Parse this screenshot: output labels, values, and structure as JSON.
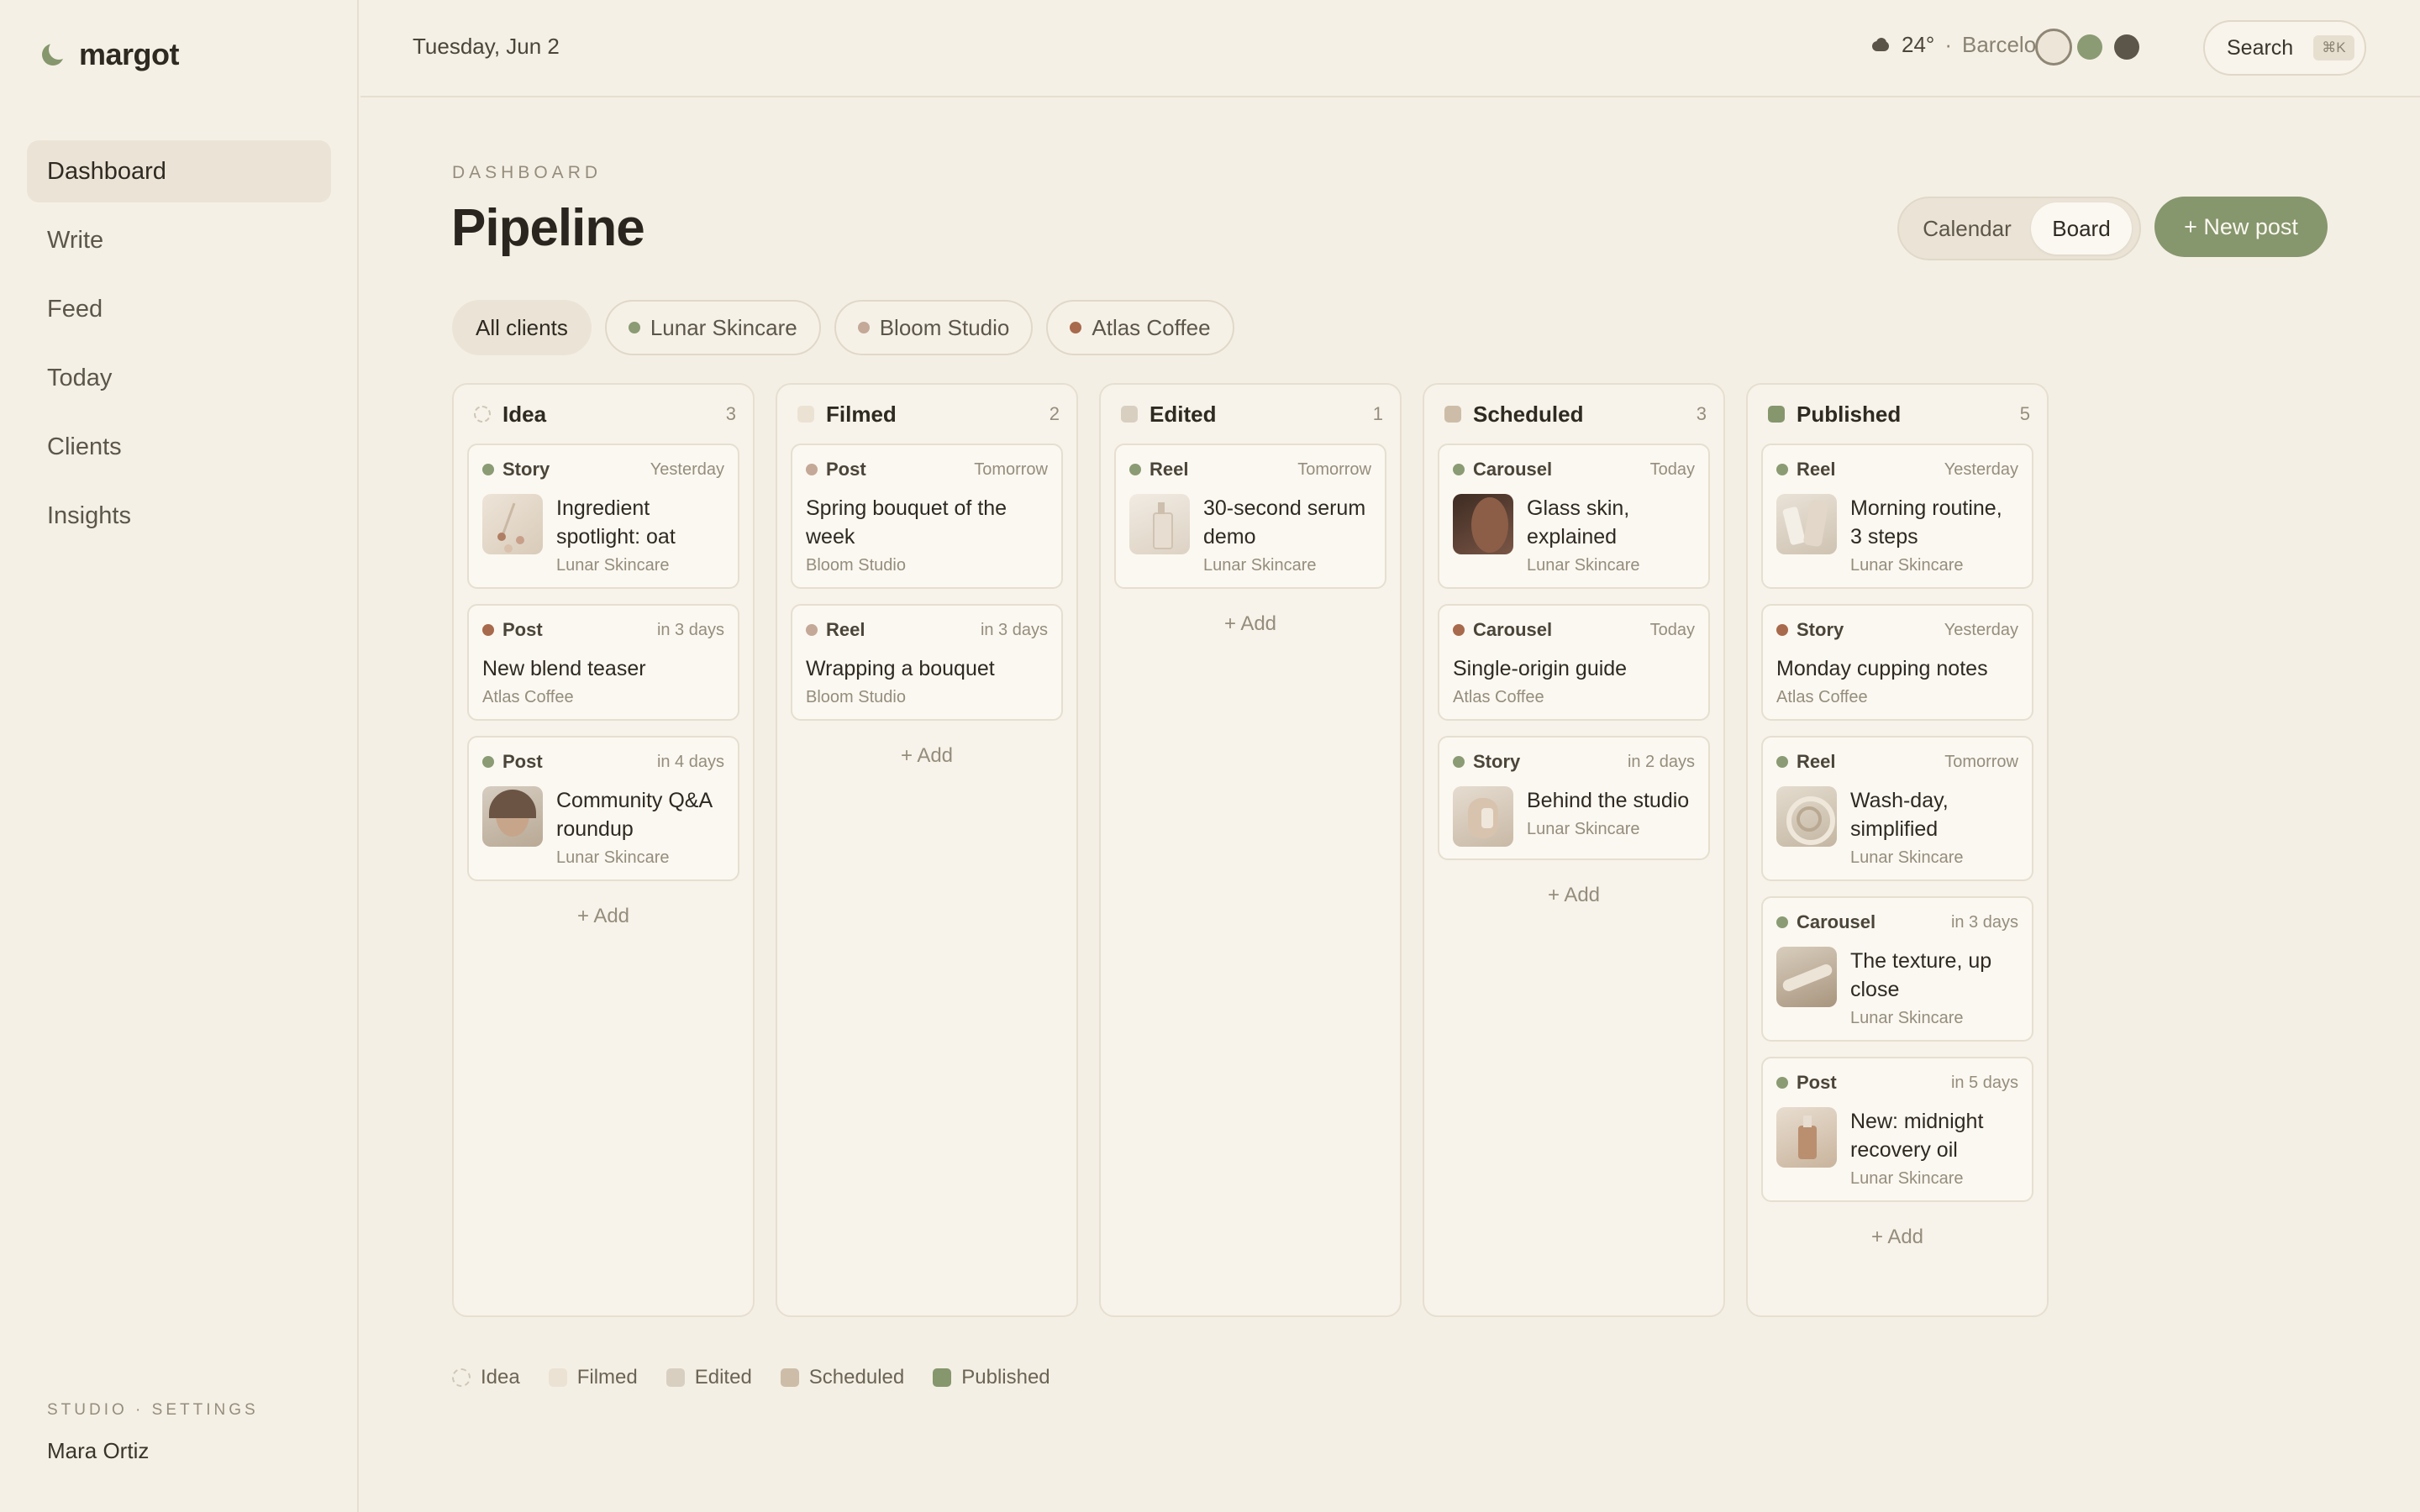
{
  "brand": {
    "name": "margot"
  },
  "nav": [
    {
      "label": "Dashboard",
      "active": true
    },
    {
      "label": "Write"
    },
    {
      "label": "Feed"
    },
    {
      "label": "Today"
    },
    {
      "label": "Clients"
    },
    {
      "label": "Insights"
    }
  ],
  "sidebar_footer": {
    "links": "STUDIO · SETTINGS",
    "user": "Mara Ortiz"
  },
  "topbar": {
    "date": "Tuesday, Jun 2",
    "weather": {
      "icon": "cloud-icon",
      "temp": "24°",
      "sep": "·",
      "city": "Barcelona"
    },
    "theme_swatches": [
      "#ede6d8",
      "#8b9b74",
      "#5c554a"
    ],
    "search": {
      "label": "Search",
      "shortcut": "⌘K"
    }
  },
  "header": {
    "eyebrow": "DASHBOARD",
    "title": "Pipeline",
    "views": [
      "Calendar",
      "Board"
    ],
    "active_view": "Board",
    "new_post": "+ New post"
  },
  "filters": [
    {
      "label": "All clients",
      "active": true
    },
    {
      "label": "Lunar Skincare",
      "color": "#8b9b74"
    },
    {
      "label": "Bloom Studio",
      "color": "#c4a898"
    },
    {
      "label": "Atlas Coffee",
      "color": "#a86a4c"
    }
  ],
  "colors": {
    "accent": "#86966d",
    "idea": "transparent",
    "filmed": "#ebe2d4",
    "edited": "#d8cfc1",
    "scheduled": "#cdbda8",
    "published": "#86966d"
  },
  "columns": [
    {
      "title": "Idea",
      "count": "3",
      "status": "idea",
      "cards": [
        {
          "type": "Story",
          "when": "Yesterday",
          "title": "Ingredient spotlight: oat",
          "client": "Lunar Skincare",
          "dot": "#8b9b74",
          "thumb": "th-oat"
        },
        {
          "type": "Post",
          "when": "in 3 days",
          "title": "New blend teaser",
          "client": "Atlas Coffee",
          "dot": "#a86a4c"
        },
        {
          "type": "Post",
          "when": "in 4 days",
          "title": "Community Q&A roundup",
          "client": "Lunar Skincare",
          "dot": "#8b9b74",
          "thumb": "th-face"
        }
      ],
      "add": "+ Add"
    },
    {
      "title": "Filmed",
      "count": "2",
      "status": "filmed",
      "cards": [
        {
          "type": "Post",
          "when": "Tomorrow",
          "title": "Spring bouquet of the week",
          "client": "Bloom Studio",
          "dot": "#c4a898"
        },
        {
          "type": "Reel",
          "when": "in 3 days",
          "title": "Wrapping a bouquet",
          "client": "Bloom Studio",
          "dot": "#c4a898"
        }
      ],
      "add": "+ Add"
    },
    {
      "title": "Edited",
      "count": "1",
      "status": "edited",
      "cards": [
        {
          "type": "Reel",
          "when": "Tomorrow",
          "title": "30-second serum demo",
          "client": "Lunar Skincare",
          "dot": "#8b9b74",
          "thumb": "th-serum"
        }
      ],
      "add": "+ Add"
    },
    {
      "title": "Scheduled",
      "count": "3",
      "status": "scheduled",
      "cards": [
        {
          "type": "Carousel",
          "when": "Today",
          "title": "Glass skin, explained",
          "client": "Lunar Skincare",
          "dot": "#8b9b74",
          "thumb": "th-skin"
        },
        {
          "type": "Carousel",
          "when": "Today",
          "title": "Single-origin guide",
          "client": "Atlas Coffee",
          "dot": "#a86a4c"
        },
        {
          "type": "Story",
          "when": "in 2 days",
          "title": "Behind the studio",
          "client": "Lunar Skincare",
          "dot": "#8b9b74",
          "thumb": "th-studio"
        }
      ],
      "add": "+ Add"
    },
    {
      "title": "Published",
      "count": "5",
      "status": "published",
      "cards": [
        {
          "type": "Reel",
          "when": "Yesterday",
          "title": "Morning routine, 3 steps",
          "client": "Lunar Skincare",
          "dot": "#8b9b74",
          "thumb": "th-routine"
        },
        {
          "type": "Story",
          "when": "Yesterday",
          "title": "Monday cupping notes",
          "client": "Atlas Coffee",
          "dot": "#a86a4c"
        },
        {
          "type": "Reel",
          "when": "Tomorrow",
          "title": "Wash-day, simplified",
          "client": "Lunar Skincare",
          "dot": "#8b9b74",
          "thumb": "th-wash"
        },
        {
          "type": "Carousel",
          "when": "in 3 days",
          "title": "The texture, up close",
          "client": "Lunar Skincare",
          "dot": "#8b9b74",
          "thumb": "th-texture"
        },
        {
          "type": "Post",
          "when": "in 5 days",
          "title": "New: midnight recovery oil",
          "client": "Lunar Skincare",
          "dot": "#8b9b74",
          "thumb": "th-oil"
        }
      ],
      "add": "+ Add"
    }
  ],
  "legend": [
    {
      "label": "Idea",
      "status": "idea"
    },
    {
      "label": "Filmed",
      "status": "filmed"
    },
    {
      "label": "Edited",
      "status": "edited"
    },
    {
      "label": "Scheduled",
      "status": "scheduled"
    },
    {
      "label": "Published",
      "status": "published"
    }
  ]
}
